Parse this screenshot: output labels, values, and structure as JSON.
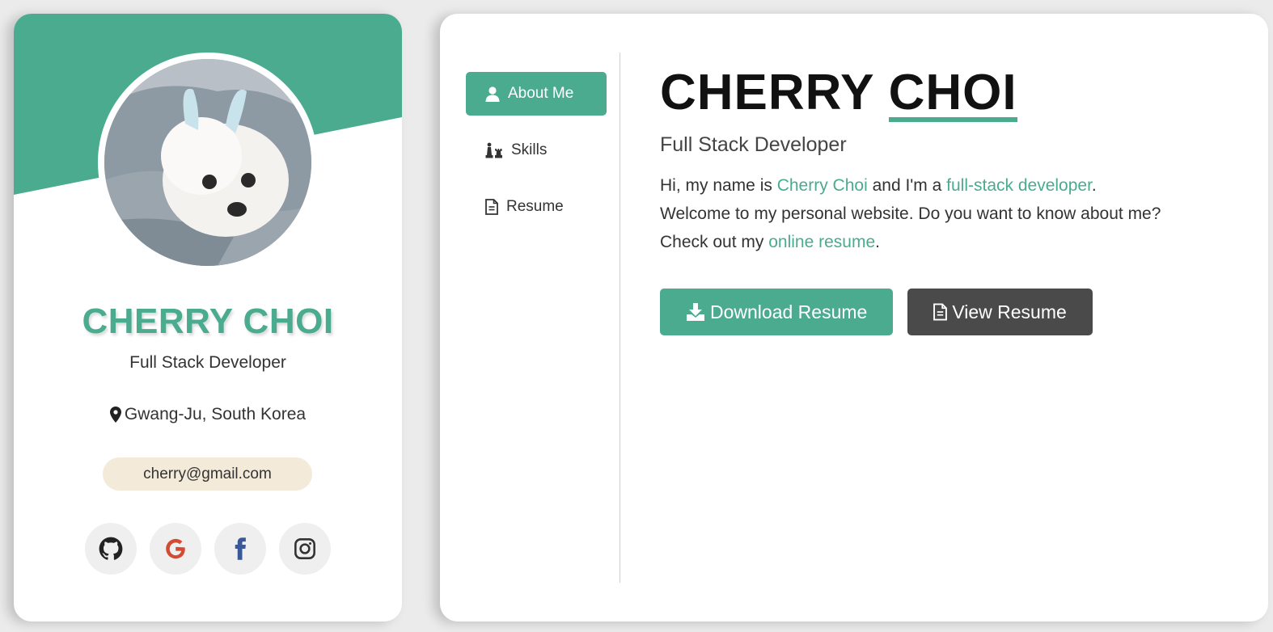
{
  "profile": {
    "name": "CHERRY CHOI",
    "role": "Full Stack Developer",
    "location": "Gwang-Ju, South Korea",
    "email": "cherry@gmail.com",
    "socials": [
      {
        "icon": "github-icon",
        "color": "#222222"
      },
      {
        "icon": "google-icon",
        "color": "#d34b32"
      },
      {
        "icon": "facebook-icon",
        "color": "#3b5998"
      },
      {
        "icon": "instagram-icon",
        "color": "#333333"
      }
    ]
  },
  "nav": {
    "items": [
      {
        "label": "About Me",
        "icon": "user-icon",
        "active": true
      },
      {
        "label": "Skills",
        "icon": "chess-icon",
        "active": false
      },
      {
        "label": "Resume",
        "icon": "document-icon",
        "active": false
      }
    ]
  },
  "about": {
    "first_name": "CHERRY",
    "last_name": "CHOI",
    "role": "Full Stack Developer",
    "intro": {
      "l1a": "Hi, my name is ",
      "l1_name": "Cherry Choi",
      "l1b": " and I'm a ",
      "l1_role": "full-stack developer",
      "l1c": ".",
      "l2": "Welcome to my personal website. Do you want to know about me?",
      "l3a": "Check out my ",
      "l3_link": "online resume",
      "l3b": "."
    },
    "download_label": "Download Resume",
    "view_label": "View Resume"
  },
  "colors": {
    "accent": "#4aab8f",
    "dark_button": "#4a4a4a",
    "email_pill": "#f3ead9"
  }
}
